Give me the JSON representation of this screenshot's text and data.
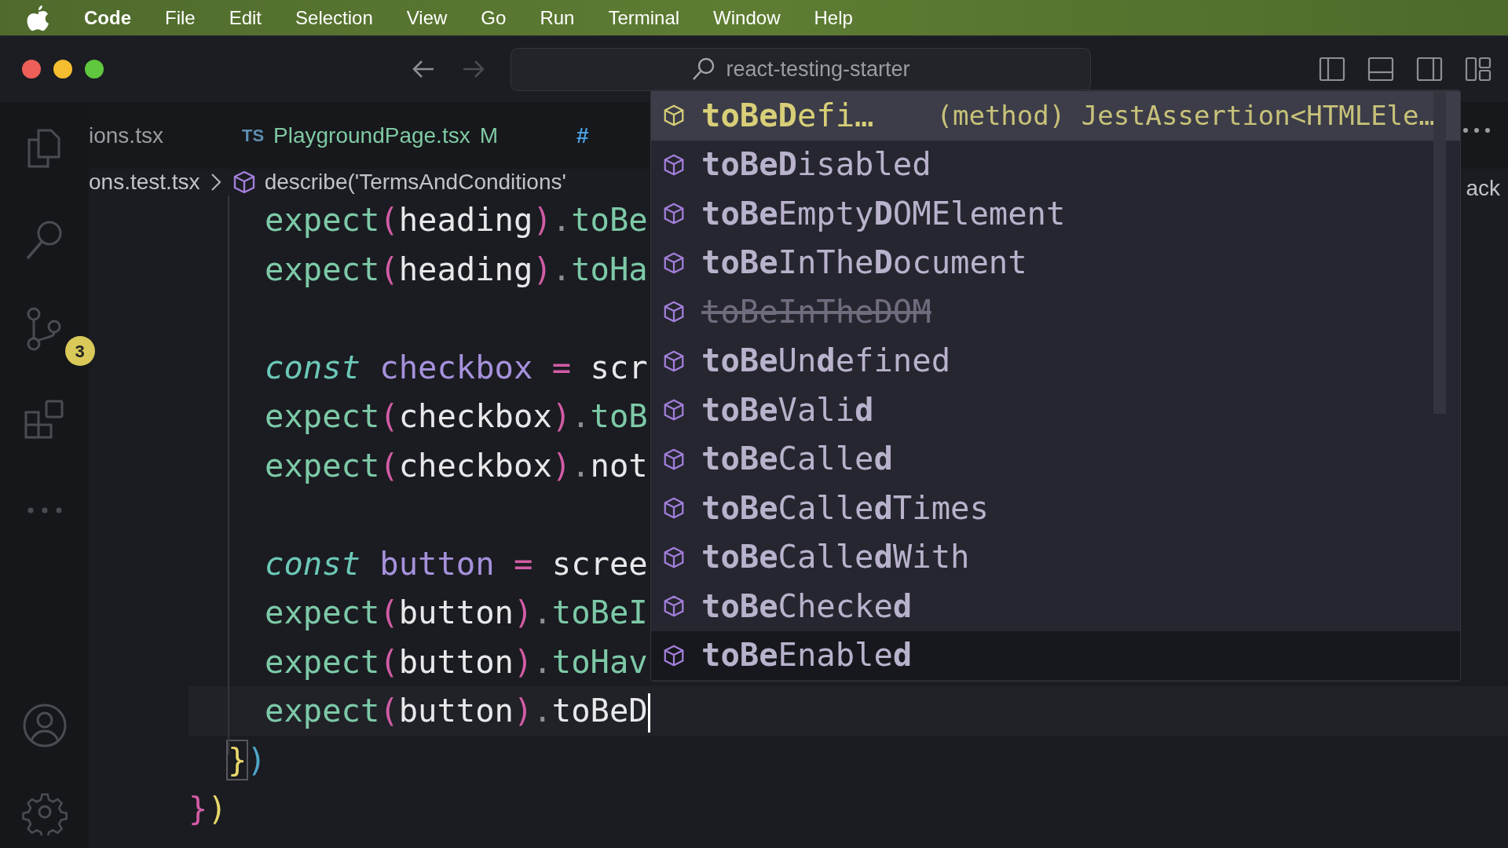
{
  "menu_bar": {
    "items": [
      {
        "label": "Code",
        "kind": "app"
      },
      {
        "label": "File",
        "kind": "menu"
      },
      {
        "label": "Edit",
        "kind": "menu"
      },
      {
        "label": "Selection",
        "kind": "menu"
      },
      {
        "label": "View",
        "kind": "menu"
      },
      {
        "label": "Go",
        "kind": "menu"
      },
      {
        "label": "Run",
        "kind": "menu"
      },
      {
        "label": "Terminal",
        "kind": "menu"
      },
      {
        "label": "Window",
        "kind": "menu"
      },
      {
        "label": "Help",
        "kind": "menu"
      }
    ]
  },
  "title_bar": {
    "search": "react-testing-starter"
  },
  "activity_bar": {
    "items": [
      {
        "kind": "explorer"
      },
      {
        "kind": "search"
      },
      {
        "kind": "source-control",
        "badge": "3"
      },
      {
        "kind": "extensions"
      },
      {
        "kind": "more"
      }
    ],
    "bottom": [
      {
        "kind": "account"
      },
      {
        "kind": "settings"
      }
    ]
  },
  "tabs": [
    {
      "label": "ions.tsx"
    },
    {
      "icon": "TS",
      "label": "PlaygroundPage.tsx",
      "status": "M"
    },
    {
      "icon": "#"
    }
  ],
  "breadcrumbs": [
    {
      "label": "ons.test.tsx",
      "kind": "file"
    },
    {
      "label": "describe('TermsAndConditions'",
      "kind": "symbol"
    }
  ],
  "breadcrumb_right": "ack",
  "code": {
    "above": [
      {
        "kind": "statement",
        "tokens": [
          {
            "text": "expect",
            "kind": "call"
          },
          {
            "text": "(",
            "kind": "paren"
          },
          {
            "text": "heading",
            "kind": "name"
          },
          {
            "text": ")",
            "kind": "paren"
          },
          {
            "text": ".",
            "kind": "dot"
          },
          {
            "text": "toBe",
            "kind": "call"
          }
        ]
      },
      {
        "kind": "statement",
        "tokens": [
          {
            "text": "expect",
            "kind": "call"
          },
          {
            "text": "(",
            "kind": "paren"
          },
          {
            "text": "heading",
            "kind": "name"
          },
          {
            "text": ")",
            "kind": "paren"
          },
          {
            "text": ".",
            "kind": "dot"
          },
          {
            "text": "toHa",
            "kind": "call"
          }
        ]
      },
      {
        "kind": "empty"
      },
      {
        "kind": "statement",
        "tokens": [
          {
            "text": "const",
            "kind": "keyword"
          },
          {
            "text": "checkbox",
            "kind": "binding"
          },
          {
            "text": "=",
            "kind": "operator"
          },
          {
            "text": "scr",
            "kind": "name"
          }
        ]
      },
      {
        "kind": "statement",
        "tokens": [
          {
            "text": "expect",
            "kind": "call"
          },
          {
            "text": "(",
            "kind": "paren"
          },
          {
            "text": "checkbox",
            "kind": "name"
          },
          {
            "text": ")",
            "kind": "paren"
          },
          {
            "text": ".",
            "kind": "dot"
          },
          {
            "text": "toB",
            "kind": "call"
          }
        ]
      },
      {
        "kind": "statement",
        "tokens": [
          {
            "text": "expect",
            "kind": "call"
          },
          {
            "text": "(",
            "kind": "paren"
          },
          {
            "text": "checkbox",
            "kind": "name"
          },
          {
            "text": ")",
            "kind": "paren"
          },
          {
            "text": ".",
            "kind": "dot"
          },
          {
            "text": "not",
            "kind": "name"
          }
        ]
      },
      {
        "kind": "empty"
      },
      {
        "kind": "statement",
        "tokens": [
          {
            "text": "const",
            "kind": "keyword"
          },
          {
            "text": "button",
            "kind": "binding"
          },
          {
            "text": "=",
            "kind": "operator"
          },
          {
            "text": "scree",
            "kind": "name"
          }
        ]
      },
      {
        "kind": "statement",
        "tokens": [
          {
            "text": "expect",
            "kind": "call"
          },
          {
            "text": "(",
            "kind": "paren"
          },
          {
            "text": "button",
            "kind": "name"
          },
          {
            "text": ")",
            "kind": "paren"
          },
          {
            "text": ".",
            "kind": "dot"
          },
          {
            "text": "toBeI",
            "kind": "call"
          }
        ]
      },
      {
        "kind": "statement",
        "tokens": [
          {
            "text": "expect",
            "kind": "call"
          },
          {
            "text": "(",
            "kind": "paren"
          },
          {
            "text": "button",
            "kind": "name"
          },
          {
            "text": ")",
            "kind": "paren"
          },
          {
            "text": ".",
            "kind": "dot"
          },
          {
            "text": "toHav",
            "kind": "call"
          }
        ]
      }
    ],
    "current": {
      "kind": "statement",
      "tokens": [
        {
          "text": "expect",
          "kind": "call"
        },
        {
          "text": "(",
          "kind": "paren"
        },
        {
          "text": "button",
          "kind": "name"
        },
        {
          "text": ")",
          "kind": "paren"
        },
        {
          "text": ".",
          "kind": "dot"
        },
        {
          "text": "toBeD",
          "kind": "name"
        }
      ]
    },
    "below": [
      {
        "kind": "inner-close",
        "tokens": [
          {
            "text": "}",
            "kind": "brace-gold-match"
          },
          {
            "text": ")",
            "kind": "paren-blue"
          }
        ]
      },
      {
        "kind": "outer-close",
        "tokens": [
          {
            "text": "}",
            "kind": "brace-pink"
          },
          {
            "text": ")",
            "kind": "paren-gold"
          }
        ]
      }
    ]
  },
  "suggestions": [
    {
      "label": "**toBeD**efi…",
      "detail": "(method) JestAssertion<HTMLEle…",
      "selected": true,
      "hovered": false,
      "deprecated": false
    },
    {
      "label": "**toBeD**isabled",
      "selected": false,
      "hovered": false,
      "deprecated": false
    },
    {
      "label": "**toBe**Empty**D**OMElement",
      "selected": false,
      "hovered": false,
      "deprecated": false
    },
    {
      "label": "**toBe**InThe**D**ocument",
      "selected": false,
      "hovered": false,
      "deprecated": false
    },
    {
      "label": "toBeInTheDOM",
      "selected": false,
      "hovered": false,
      "deprecated": true
    },
    {
      "label": "**toBe**Un**d**efined",
      "selected": false,
      "hovered": false,
      "deprecated": false
    },
    {
      "label": "**toBe**Vali**d**",
      "selected": false,
      "hovered": false,
      "deprecated": false
    },
    {
      "label": "**toBe**Calle**d**",
      "selected": false,
      "hovered": false,
      "deprecated": false
    },
    {
      "label": "**toBe**Calle**d**Times",
      "selected": false,
      "hovered": false,
      "deprecated": false
    },
    {
      "label": "**toBe**Calle**d**With",
      "selected": false,
      "hovered": false,
      "deprecated": false
    },
    {
      "label": "**toBe**Checke**d**",
      "selected": false,
      "hovered": false,
      "deprecated": false
    },
    {
      "label": "**toBe**Enable**d**",
      "selected": false,
      "hovered": true,
      "deprecated": false
    }
  ]
}
